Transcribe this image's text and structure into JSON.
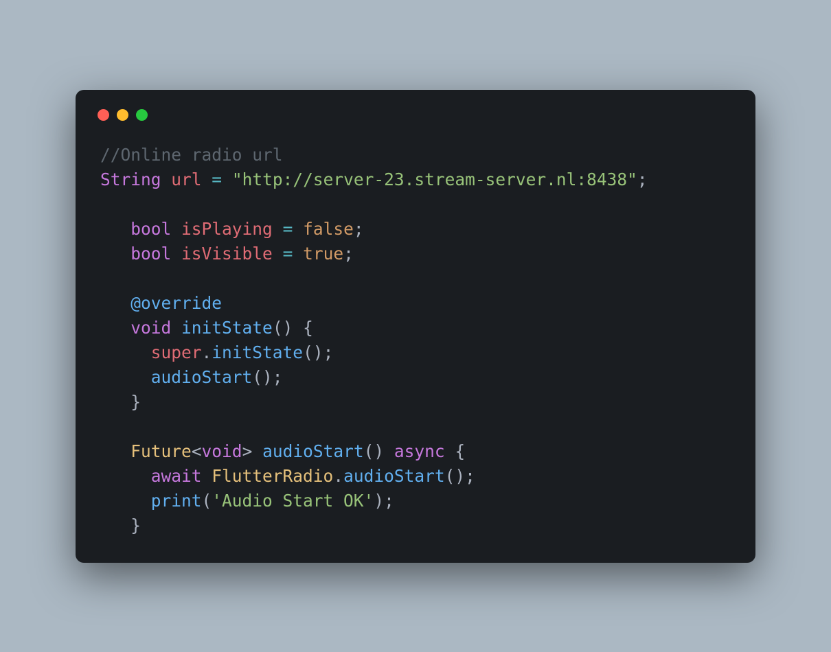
{
  "code": {
    "comment": "//Online radio url",
    "line2_type": "String",
    "line2_ident": "url",
    "line2_eq": " = ",
    "line2_string": "\"http://server-23.stream-server.nl:8438\"",
    "line2_semi": ";",
    "indent1": "   ",
    "line4_type": "bool",
    "line4_ident": "isPlaying",
    "line4_eq": " = ",
    "line4_val": "false",
    "line4_semi": ";",
    "line5_type": "bool",
    "line5_ident": "isVisible",
    "line5_eq": " = ",
    "line5_val": "true",
    "line5_semi": ";",
    "line7_annot": "@override",
    "line8_void": "void",
    "line8_func": "initState",
    "line8_parens": "() {",
    "indent2": "     ",
    "line9_super": "super",
    "line9_dot": ".",
    "line9_func": "initState",
    "line9_tail": "();",
    "line10_func": "audioStart",
    "line10_tail": "();",
    "line11_close": "}",
    "line13_future": "Future",
    "line13_lt": "<",
    "line13_void": "void",
    "line13_gt": ">",
    "line13_func": "audioStart",
    "line13_parens": "() ",
    "line13_async": "async",
    "line13_brace": " {",
    "line14_await": "await",
    "line14_class": "FlutterRadio",
    "line14_dot": ".",
    "line14_func": "audioStart",
    "line14_tail": "();",
    "line15_func": "print",
    "line15_open": "(",
    "line15_string": "'Audio Start OK'",
    "line15_close": ");",
    "line16_close": "}"
  }
}
